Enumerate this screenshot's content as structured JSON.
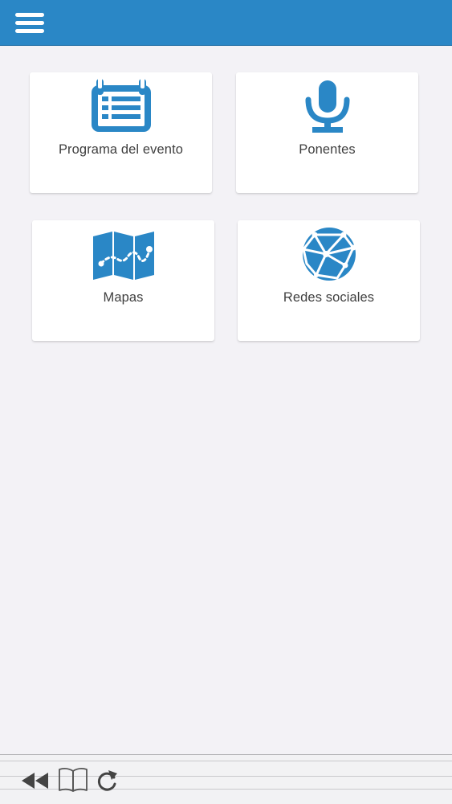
{
  "header": {
    "menu_icon": "hamburger-menu-icon",
    "background_color": "#2a87c6"
  },
  "tiles": [
    {
      "label": "Programa del evento",
      "icon": "calendar-icon"
    },
    {
      "label": "Ponentes",
      "icon": "microphone-icon"
    },
    {
      "label": "Mapas",
      "icon": "map-icon"
    },
    {
      "label": "Redes sociales",
      "icon": "network-globe-icon"
    }
  ],
  "colors": {
    "accent": "#2a87c6",
    "background": "#f3f2f6",
    "tile_background": "#ffffff",
    "label_text": "#3f3f3f"
  },
  "browser_toolbar": {
    "back_icon": "rewind-icon",
    "bookmarks_icon": "open-book-icon",
    "reload_icon": "reload-icon"
  }
}
